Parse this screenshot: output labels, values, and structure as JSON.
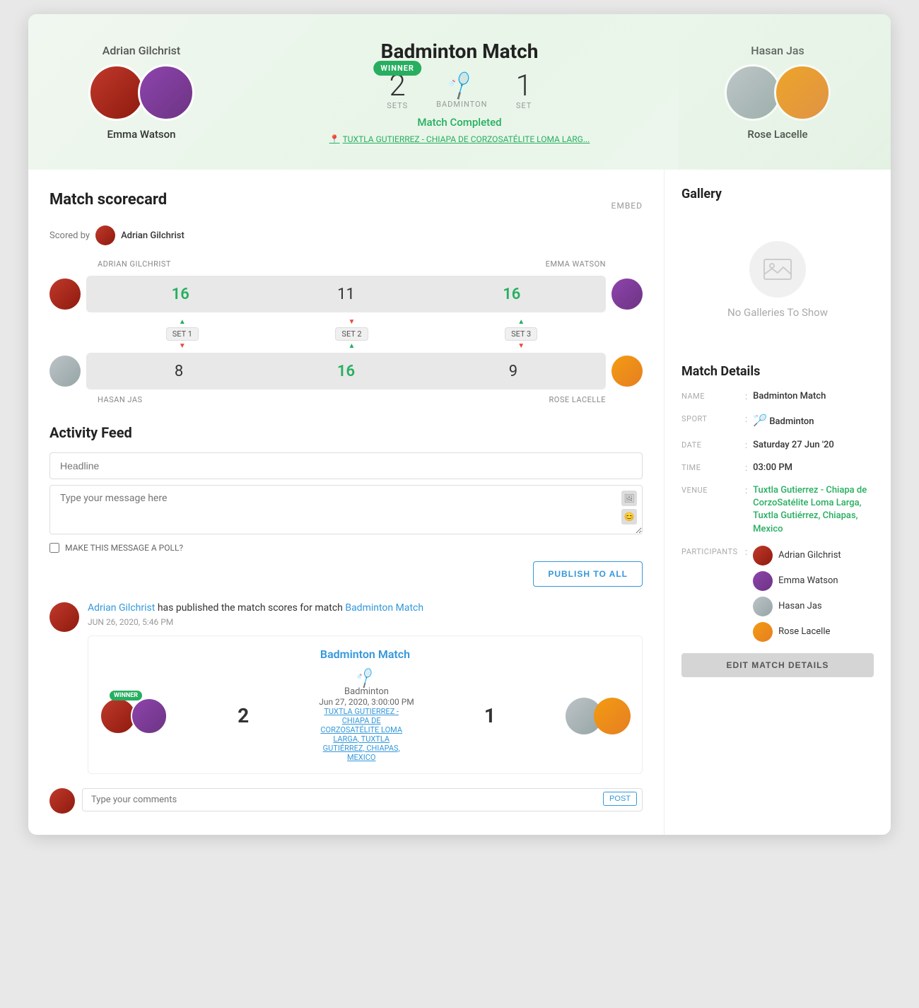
{
  "header": {
    "title": "Badminton Match",
    "sport": "Badminton",
    "sport_icon": "🏸",
    "status": "Match Completed",
    "venue": "TUXTLA GUTIERREZ - CHIAPA DE CORZOSATÉLITE LOMA LARG...",
    "team1": {
      "players": [
        {
          "name": "Adrian Gilchrist",
          "avatarClass": "avatar-red"
        },
        {
          "name": "Emma Watson",
          "avatarClass": "avatar-purple"
        }
      ],
      "bottom_name": "Emma Watson",
      "sets": "2",
      "sets_label": "SETS"
    },
    "team2": {
      "players": [
        {
          "name": "Hasan Jas",
          "avatarClass": "avatar-man"
        },
        {
          "name": "Rose Lacelle",
          "avatarClass": "avatar-woman"
        }
      ],
      "bottom_name": "Rose Lacelle",
      "sets": "1",
      "sets_label": "SET"
    },
    "winner_badge": "WINNER"
  },
  "scorecard": {
    "title": "Match scorecard",
    "embed_label": "EMBED",
    "scored_by_label": "Scored by",
    "scored_by_name": "Adrian Gilchrist",
    "team1_label": "ADRIAN GILCHRIST",
    "team2_label": "EMMA WATSON",
    "team3_label": "HASAN JAS",
    "team4_label": "ROSE LACELLE",
    "row1_scores": [
      {
        "value": "16",
        "winner": true
      },
      {
        "value": "11",
        "winner": false
      },
      {
        "value": "16",
        "winner": true
      }
    ],
    "row2_scores": [
      {
        "value": "8",
        "winner": false
      },
      {
        "value": "16",
        "winner": true
      },
      {
        "value": "9",
        "winner": false
      }
    ],
    "sets": [
      {
        "label": "SET 1",
        "top_arrow": "▲",
        "bottom_arrow": "▼",
        "top_color": "green",
        "bottom_color": "red"
      },
      {
        "label": "SET 2",
        "top_arrow": "▼",
        "bottom_arrow": "▲",
        "top_color": "red",
        "bottom_color": "green"
      },
      {
        "label": "SET 3",
        "top_arrow": "▲",
        "bottom_arrow": "▼",
        "top_color": "green",
        "bottom_color": "red"
      }
    ]
  },
  "activity": {
    "title": "Activity Feed",
    "headline_placeholder": "Headline",
    "message_placeholder": "Type your message here",
    "poll_label": "MAKE THIS MESSAGE A POLL?",
    "publish_btn": "PUBLISH TO ALL",
    "feed_items": [
      {
        "user": "Adrian Gilchrist",
        "action": " has published the match scores for match ",
        "match_link": "Badminton Match",
        "time": "JUN 26, 2020, 5:46 PM"
      }
    ],
    "match_card": {
      "title": "Badminton Match",
      "sport": "Badminton",
      "date": "Jun 27, 2020, 3:00:00 PM",
      "venue": "TUXTLA GUTIERREZ - CHIAPA DE CORZOSATÉLITE LOMA LARGA, TUXTLA GUTIÉRREZ, CHIAPAS, MEXICO",
      "team1_score": "2",
      "team2_score": "1",
      "winner_badge": "WINNER"
    },
    "comment_placeholder": "Type your comments",
    "post_btn": "POST"
  },
  "gallery": {
    "title": "Gallery",
    "empty_text": "No Galleries To Show"
  },
  "match_details": {
    "title": "Match Details",
    "fields": [
      {
        "label": "NAME",
        "value": "Badminton Match",
        "link": false
      },
      {
        "label": "SPORT",
        "value": "Badminton",
        "link": false,
        "has_icon": true
      },
      {
        "label": "DATE",
        "value": "Saturday 27 Jun '20",
        "link": false
      },
      {
        "label": "TIME",
        "value": "03:00 PM",
        "link": false
      },
      {
        "label": "VENUE",
        "value": "Tuxtla Gutierrez - Chiapa de CorzoSatélite Loma Larga, Tuxtla Gutiérrez, Chiapas, Mexico",
        "link": true
      }
    ],
    "participants_label": "PARTICIPANTS",
    "participants": [
      {
        "name": "Adrian Gilchrist",
        "avatarClass": "pa-red"
      },
      {
        "name": "Emma Watson",
        "avatarClass": "pa-purple"
      },
      {
        "name": "Hasan Jas",
        "avatarClass": "pa-gray"
      },
      {
        "name": "Rose Lacelle",
        "avatarClass": "pa-orange"
      }
    ],
    "edit_btn": "EDIT MATCH DETAILS"
  }
}
